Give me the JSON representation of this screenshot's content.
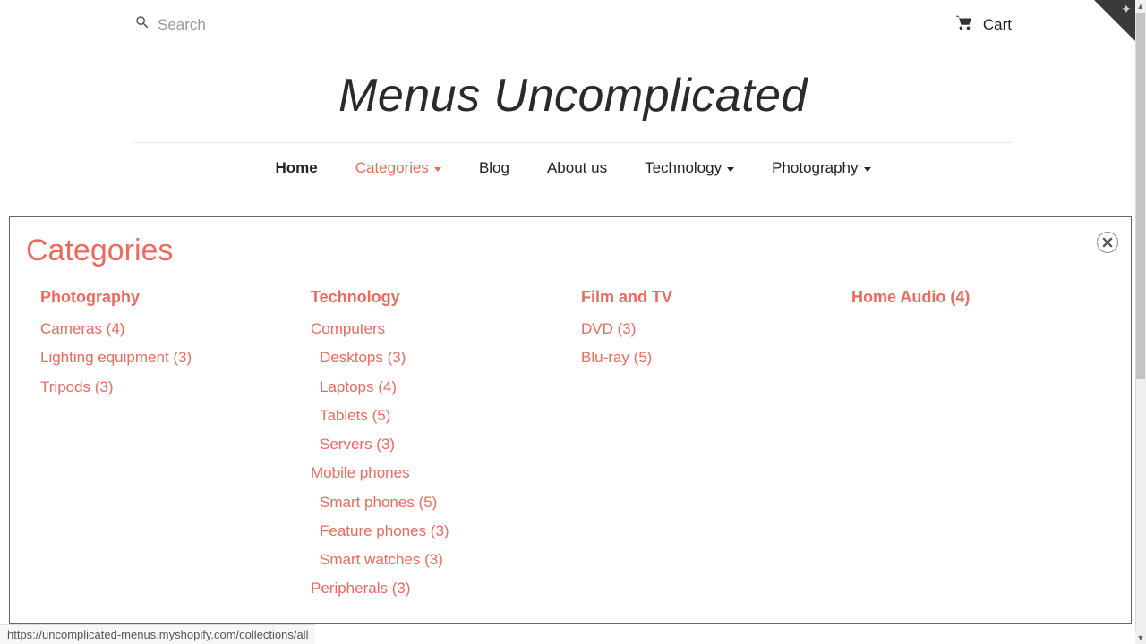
{
  "topbar": {
    "search_placeholder": "Search",
    "cart_label": "Cart"
  },
  "site_title": "Menus Uncomplicated",
  "nav": {
    "home": "Home",
    "categories": "Categories",
    "blog": "Blog",
    "about": "About us",
    "technology": "Technology",
    "photography": "Photography"
  },
  "panel": {
    "title": "Categories",
    "columns": {
      "photography": {
        "heading": "Photography",
        "items": [
          "Cameras (4)",
          "Lighting equipment (3)",
          "Tripods (3)"
        ]
      },
      "technology": {
        "heading": "Technology",
        "groups": [
          {
            "label": "Computers",
            "children": [
              "Desktops (3)",
              "Laptops (4)",
              "Tablets (5)",
              "Servers (3)"
            ]
          },
          {
            "label": "Mobile phones",
            "children": [
              "Smart phones (5)",
              "Feature phones (3)",
              "Smart watches (3)"
            ]
          },
          {
            "label": "Peripherals (3)",
            "children": []
          }
        ]
      },
      "film_tv": {
        "heading": "Film and TV",
        "items": [
          "DVD (3)",
          "Blu-ray (5)"
        ]
      },
      "home_audio": {
        "heading": "Home Audio (4)"
      }
    }
  },
  "status_url": "https://uncomplicated-menus.myshopify.com/collections/all",
  "accent_color": "#ec6a5e"
}
